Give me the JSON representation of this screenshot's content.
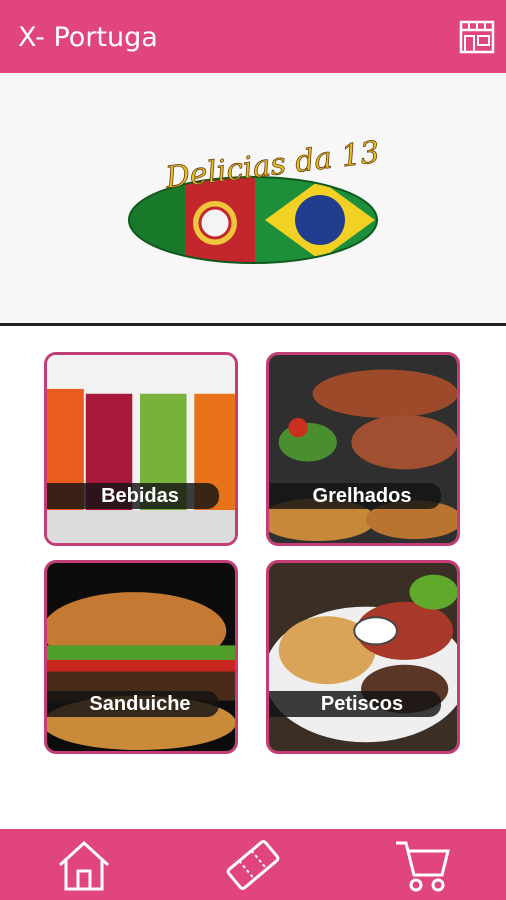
{
  "header": {
    "title": "X- Portuga",
    "store_icon": "store-icon"
  },
  "banner": {
    "logo_text": "Delicias da 13"
  },
  "menu": {
    "categories": [
      {
        "label": "Bebidas"
      },
      {
        "label": "Grelhados"
      },
      {
        "label": "Sanduiche"
      },
      {
        "label": "Petiscos"
      }
    ]
  },
  "bottom_nav": {
    "items": [
      {
        "icon": "home-icon"
      },
      {
        "icon": "ticket-icon"
      },
      {
        "icon": "cart-icon"
      }
    ]
  },
  "colors": {
    "brand": "#e0457e",
    "tile_border": "#c33d76"
  }
}
